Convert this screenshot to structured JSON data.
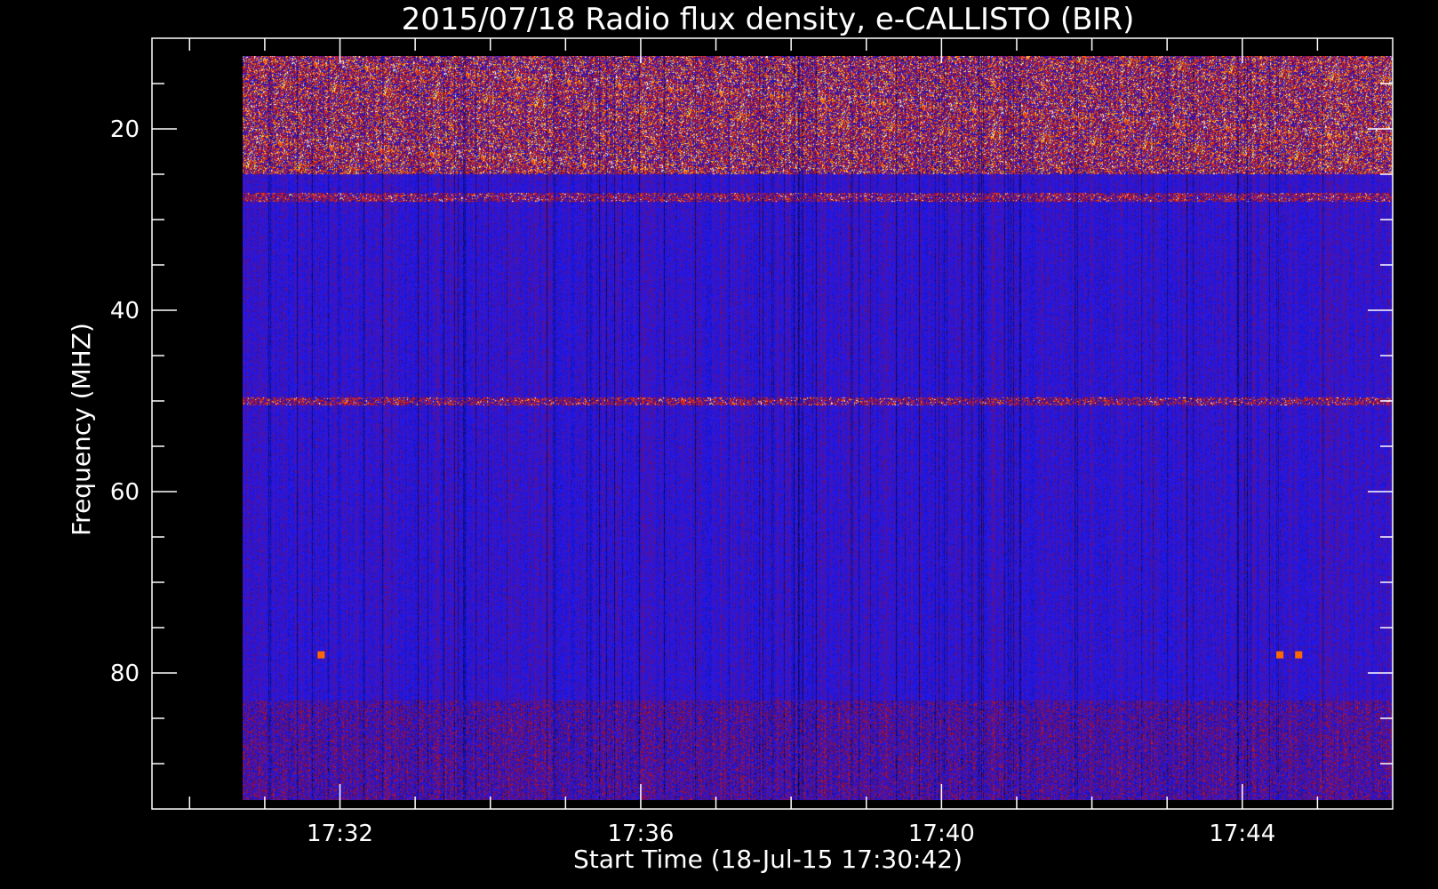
{
  "chart_data": {
    "type": "heatmap",
    "title": "2015/07/18  Radio flux density, e-CALLISTO (BIR)",
    "xlabel": "Start Time (18-Jul-15 17:30:42)",
    "ylabel": "Frequency (MHZ)",
    "x_start": "17:30:42",
    "x_end": "17:46:00",
    "xlim": [
      "17:29:30",
      "17:46:00"
    ],
    "ylim": [
      95,
      10
    ],
    "data_extent_mhz": [
      12,
      94
    ],
    "x_ticks": [
      "17:32",
      "17:36",
      "17:40",
      "17:44"
    ],
    "y_ticks": [
      20,
      40,
      60,
      80
    ],
    "colormap": [
      "#000000",
      "#1a1aff",
      "#8b0a3a",
      "#ff3000",
      "#ffd000",
      "#ffffff"
    ],
    "background_level": "blue",
    "bands": [
      {
        "label": "strong interference",
        "freq_range_mhz": [
          12,
          25
        ],
        "level": "high"
      },
      {
        "label": "band edge",
        "freq_range_mhz": [
          27,
          28
        ],
        "level": "medium"
      },
      {
        "label": "line",
        "freq_mhz": 50,
        "level": "medium"
      },
      {
        "label": "noisy band",
        "freq_range_mhz": [
          83,
          94
        ],
        "level": "low-medium"
      }
    ],
    "bursts": [
      {
        "time": "17:31:45",
        "freq_mhz": 78
      },
      {
        "time": "17:44:30",
        "freq_mhz": 78
      },
      {
        "time": "17:44:45",
        "freq_mhz": 78
      }
    ]
  }
}
